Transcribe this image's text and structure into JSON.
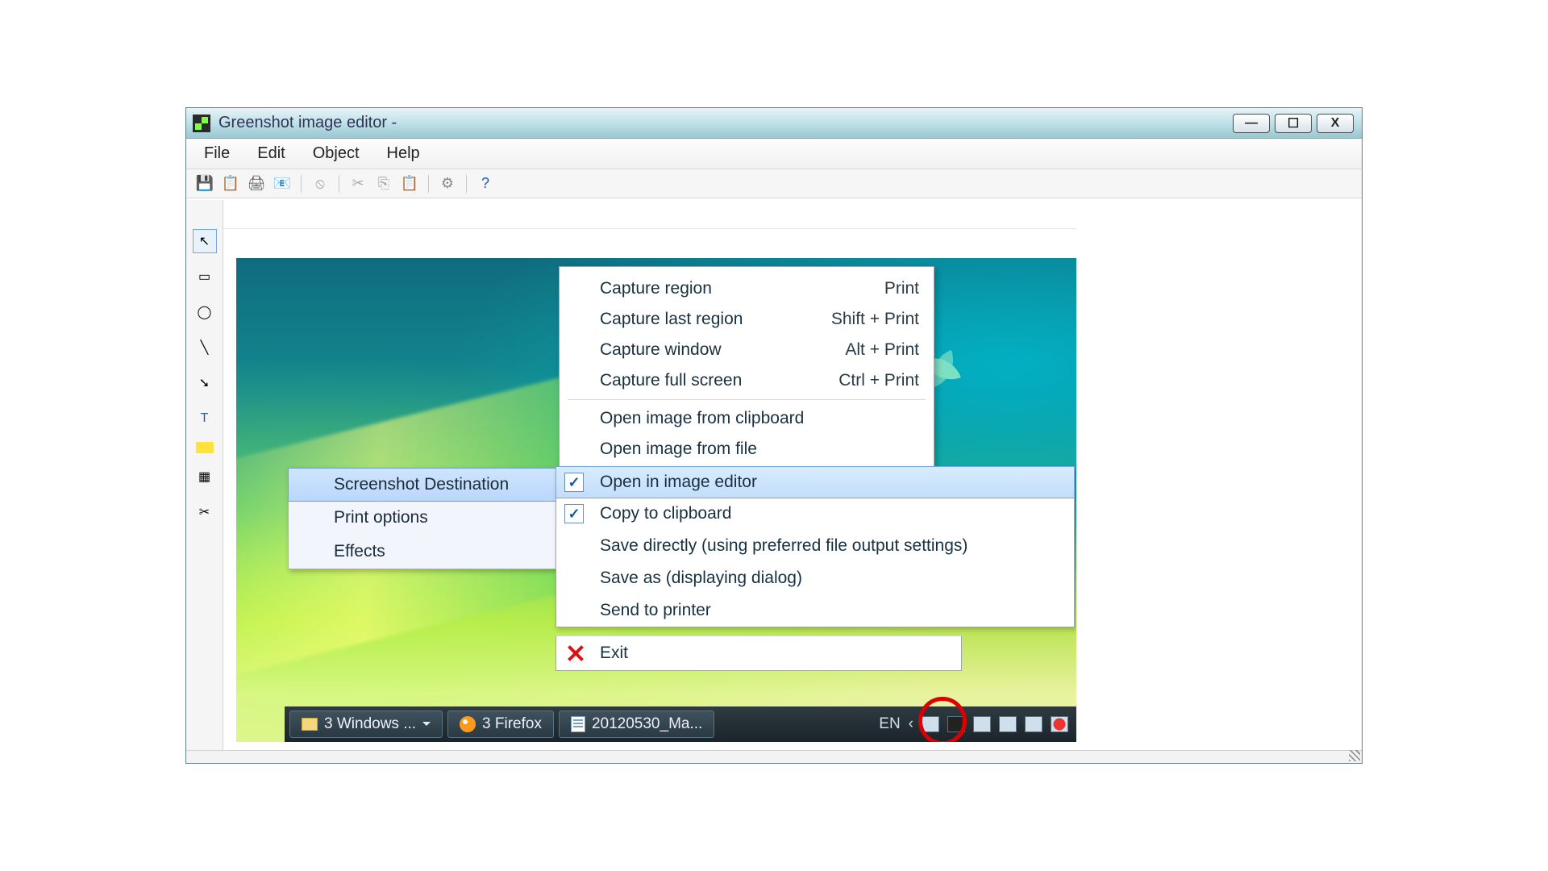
{
  "window": {
    "title": "Greenshot image editor -"
  },
  "menubar": {
    "file": "File",
    "edit": "Edit",
    "object": "Object",
    "help": "Help"
  },
  "context_menu": {
    "items": [
      {
        "label": "Capture region",
        "shortcut": "Print"
      },
      {
        "label": "Capture last region",
        "shortcut": "Shift + Print"
      },
      {
        "label": "Capture window",
        "shortcut": "Alt + Print"
      },
      {
        "label": "Capture full screen",
        "shortcut": "Ctrl + Print"
      }
    ],
    "items2": [
      {
        "label": "Open image from clipboard"
      },
      {
        "label": "Open image from file"
      }
    ]
  },
  "settings_submenu": {
    "items": [
      {
        "label": "Screenshot Destination",
        "hi": true
      },
      {
        "label": "Print options"
      },
      {
        "label": "Effects"
      }
    ]
  },
  "destination_submenu": {
    "items": [
      {
        "label": "Open in image editor",
        "checked": true,
        "hi": true
      },
      {
        "label": "Copy to clipboard",
        "checked": true
      },
      {
        "label": "Save directly (using preferred file output settings)"
      },
      {
        "label": "Save as (displaying dialog)"
      },
      {
        "label": "Send to printer"
      }
    ]
  },
  "exit": {
    "label": "Exit"
  },
  "taskbar": {
    "items": [
      {
        "label": "3 Windows ..."
      },
      {
        "label": "3 Firefox"
      },
      {
        "label": "20120530_Ma..."
      }
    ],
    "lang": "EN"
  }
}
